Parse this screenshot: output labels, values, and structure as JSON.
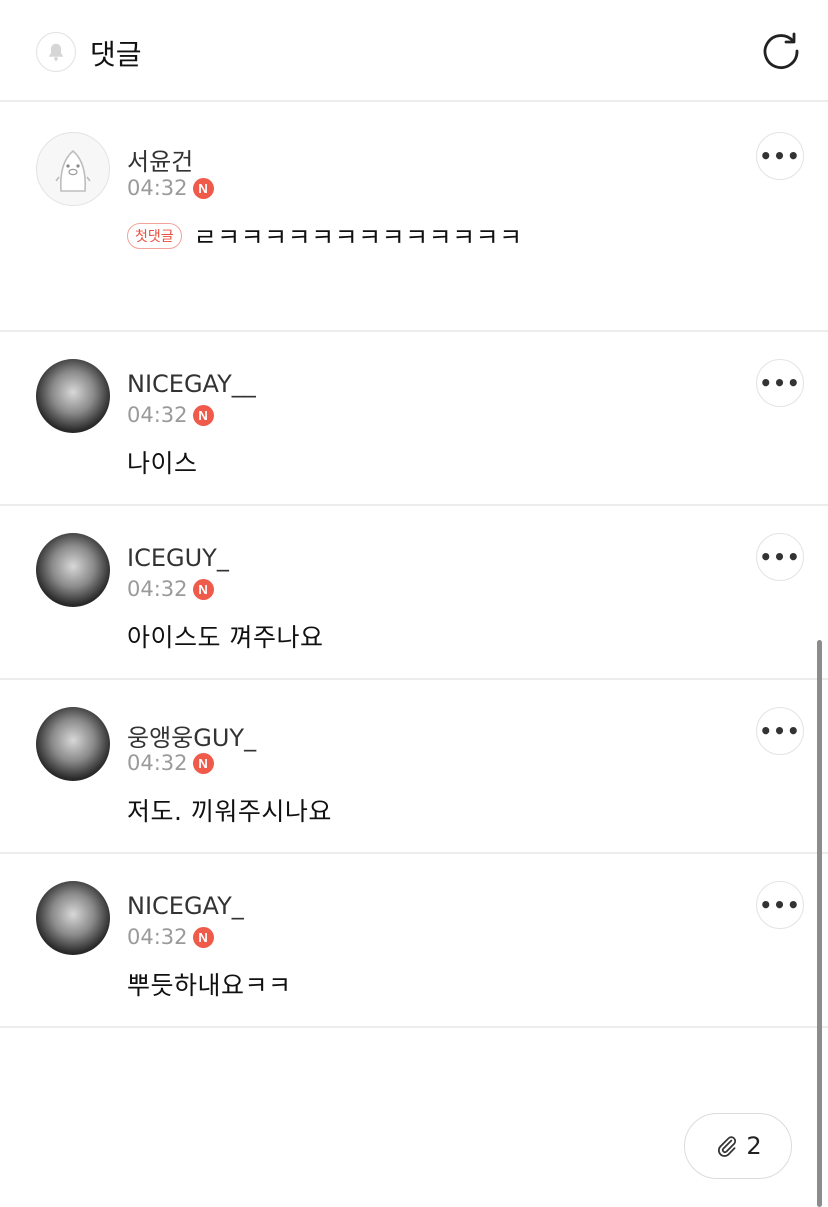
{
  "header": {
    "title": "댓글",
    "bell_icon": "bell-icon",
    "refresh_icon": "refresh-icon"
  },
  "comments": [
    {
      "nickname": "서윤건",
      "time": "04:32",
      "new_badge": "N",
      "first_badge": "첫댓글",
      "text": "ㄹㅋㅋㅋㅋㅋㅋㅋㅋㅋㅋㅋㅋㅋ",
      "avatar": "default-avatar"
    },
    {
      "nickname": "NICEGAY__",
      "time": "04:32",
      "new_badge": "N",
      "text": "나이스",
      "avatar": "photo"
    },
    {
      "nickname": "ICEGUY_",
      "time": "04:32",
      "new_badge": "N",
      "text": "아이스도 껴주나요",
      "avatar": "photo"
    },
    {
      "nickname": "웅앵웅GUY_",
      "time": "04:32",
      "new_badge": "N",
      "text": "저도. 끼워주시나요",
      "avatar": "photo"
    },
    {
      "nickname": "NICEGAY_",
      "time": "04:32",
      "new_badge": "N",
      "text": "뿌듯하내요ㅋㅋ",
      "avatar": "photo"
    }
  ],
  "more_label": "•••",
  "attachment": {
    "icon": "paperclip-icon",
    "count": "2"
  },
  "colors": {
    "accent": "#f05a4a",
    "divider": "#ececec"
  }
}
